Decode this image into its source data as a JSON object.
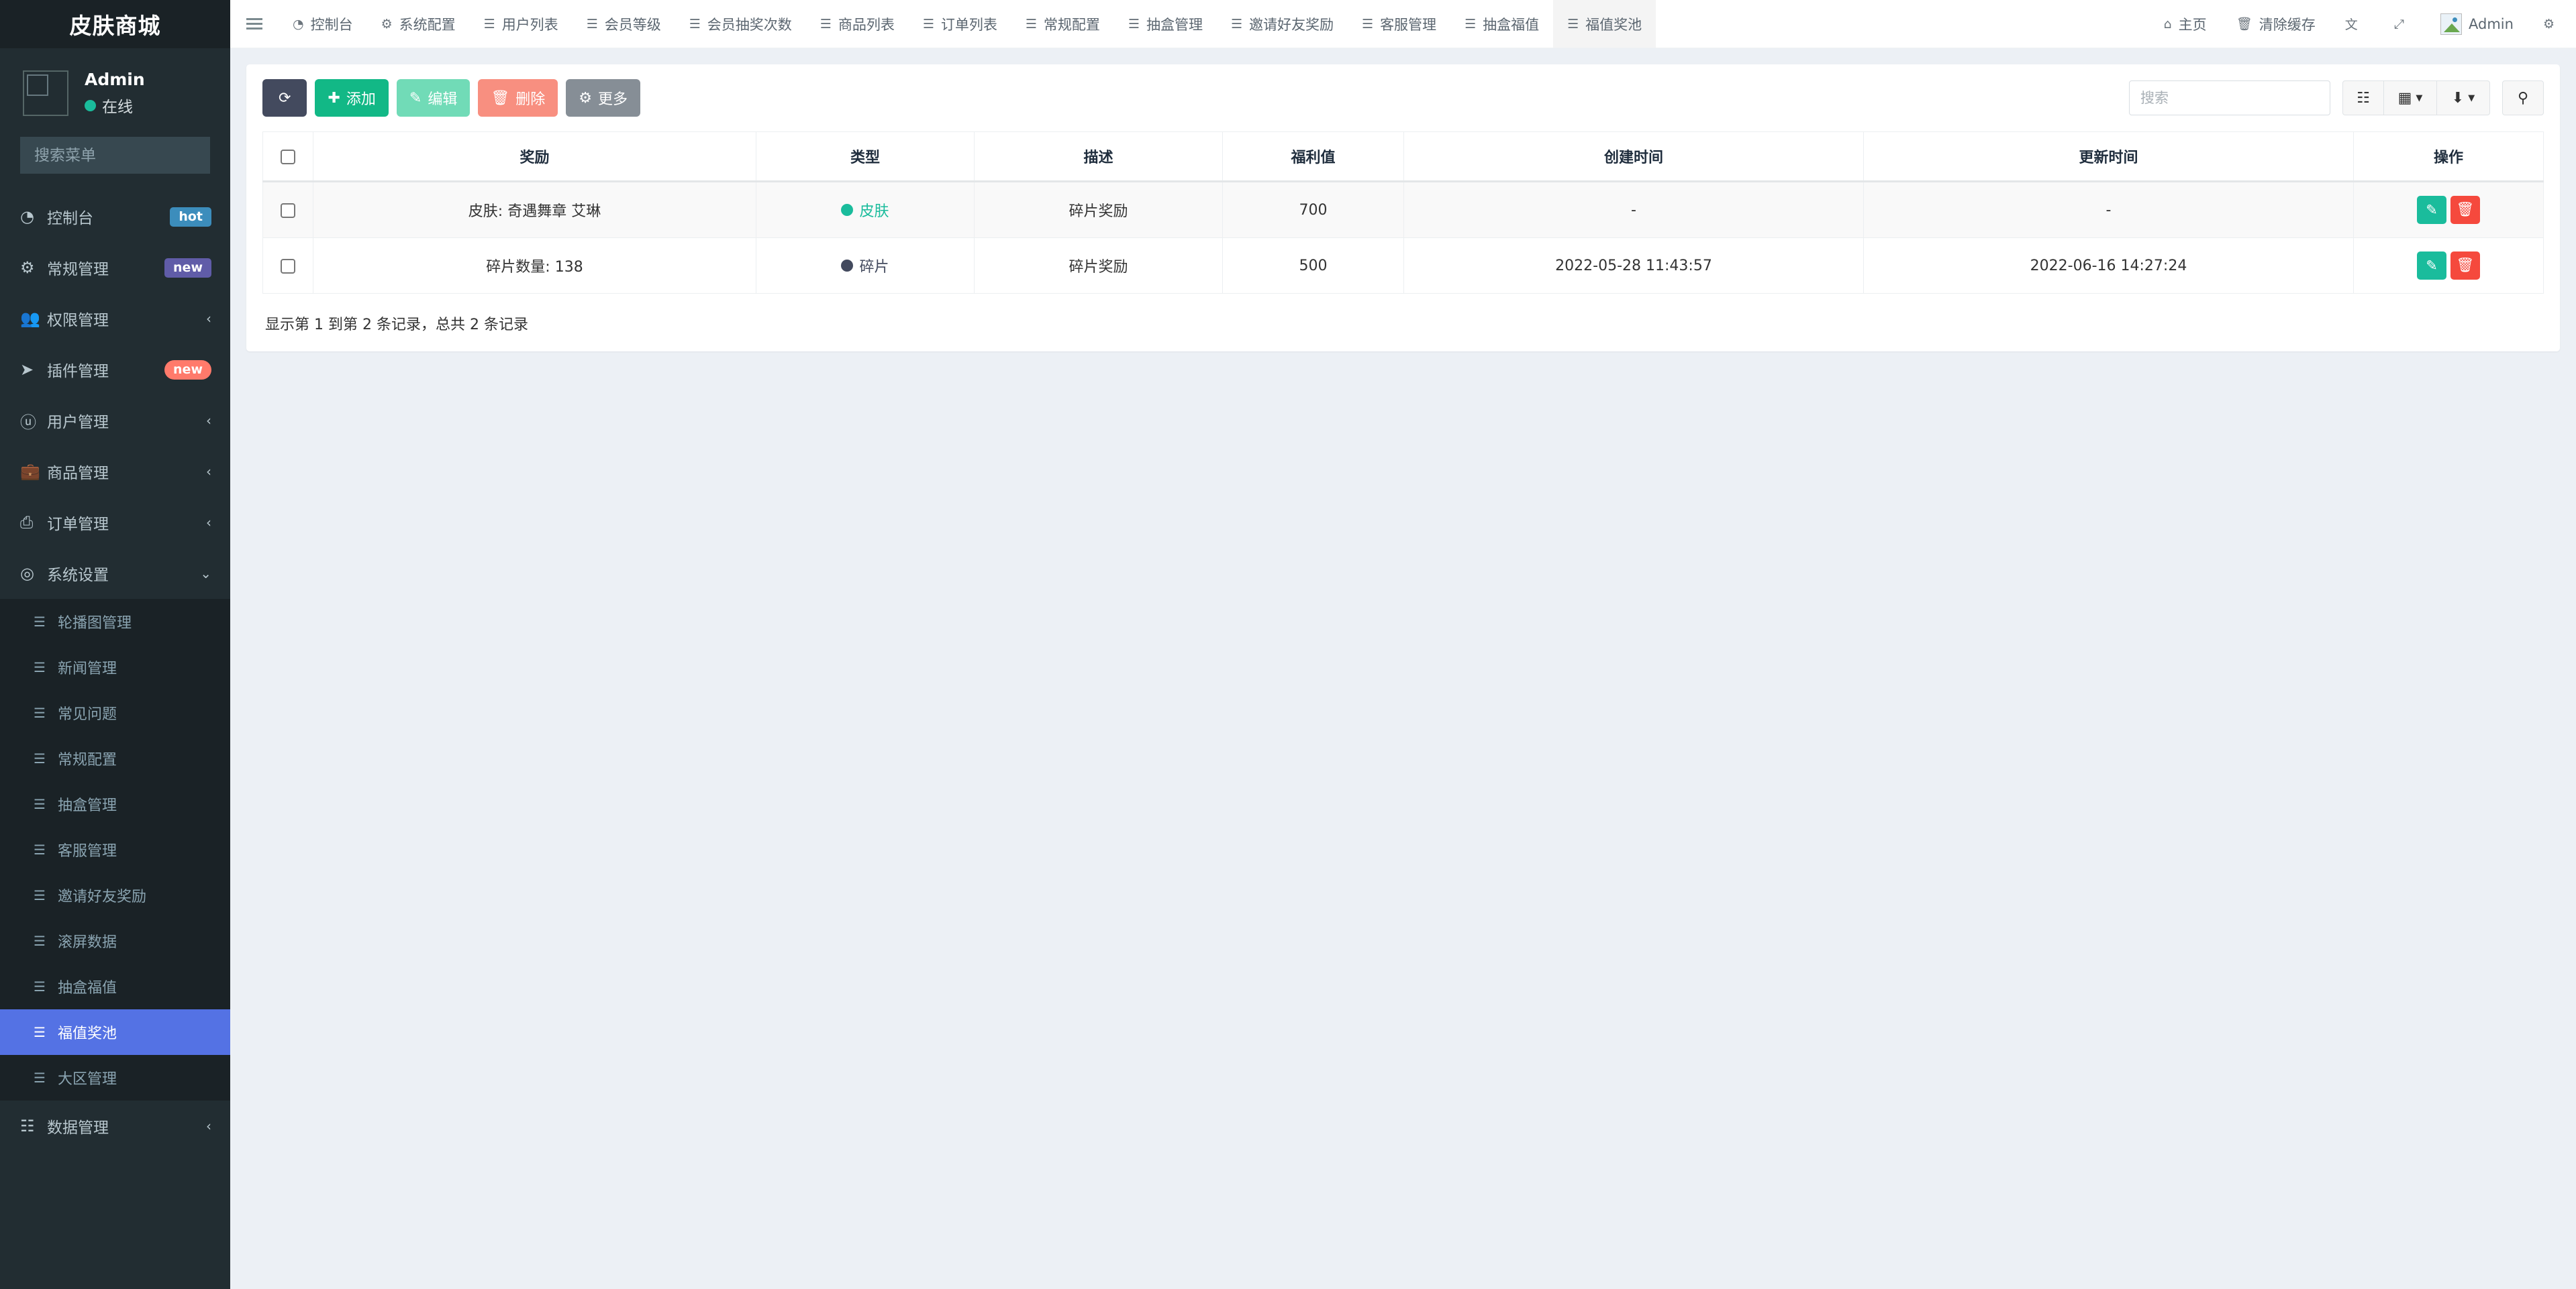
{
  "brand": {
    "title": "皮肤商城"
  },
  "user": {
    "name": "Admin",
    "status": "在线"
  },
  "menu_search": {
    "placeholder": "搜索菜单",
    "icon": "search-icon"
  },
  "sidebar": {
    "items": [
      {
        "label": "控制台",
        "icon": "dashboard-icon",
        "badge": "hot",
        "badge_style": "hot"
      },
      {
        "label": "常规管理",
        "icon": "cogs-icon",
        "badge": "new",
        "badge_style": "newp"
      },
      {
        "label": "权限管理",
        "icon": "users-icon",
        "caret": "‹"
      },
      {
        "label": "插件管理",
        "icon": "rocket-icon",
        "badge": "new",
        "badge_style": "newr"
      },
      {
        "label": "用户管理",
        "icon": "user-circle-icon",
        "caret": "‹"
      },
      {
        "label": "商品管理",
        "icon": "briefcase-icon",
        "caret": "‹"
      },
      {
        "label": "订单管理",
        "icon": "print-icon",
        "caret": "‹"
      },
      {
        "label": "系统设置",
        "icon": "circle-target-icon",
        "caret": "⌄"
      }
    ],
    "submenu": [
      {
        "label": "轮播图管理",
        "icon": "list-icon"
      },
      {
        "label": "新闻管理",
        "icon": "list-icon"
      },
      {
        "label": "常见问题",
        "icon": "list-icon"
      },
      {
        "label": "常规配置",
        "icon": "list-icon"
      },
      {
        "label": "抽盒管理",
        "icon": "list-icon"
      },
      {
        "label": "客服管理",
        "icon": "list-icon"
      },
      {
        "label": "邀请好友奖励",
        "icon": "list-icon"
      },
      {
        "label": "滚屏数据",
        "icon": "list-icon"
      },
      {
        "label": "抽盒福值",
        "icon": "list-icon"
      },
      {
        "label": "福值奖池",
        "icon": "list-icon",
        "active": true
      },
      {
        "label": "大区管理",
        "icon": "list-icon"
      }
    ],
    "tail": [
      {
        "label": "数据管理",
        "icon": "database-icon",
        "caret": "‹"
      }
    ]
  },
  "topnav": {
    "hamburger": "menu-toggle-icon",
    "tabs": [
      {
        "label": "控制台",
        "icon": "dashboard-icon"
      },
      {
        "label": "系统配置",
        "icon": "gear-icon"
      },
      {
        "label": "用户列表",
        "icon": "list-icon"
      },
      {
        "label": "会员等级",
        "icon": "list-icon"
      },
      {
        "label": "会员抽奖次数",
        "icon": "list-icon"
      },
      {
        "label": "商品列表",
        "icon": "list-icon"
      },
      {
        "label": "订单列表",
        "icon": "list-icon"
      },
      {
        "label": "常规配置",
        "icon": "list-icon"
      },
      {
        "label": "抽盒管理",
        "icon": "list-icon"
      },
      {
        "label": "邀请好友奖励",
        "icon": "list-icon"
      },
      {
        "label": "客服管理",
        "icon": "list-icon"
      },
      {
        "label": "抽盒福值",
        "icon": "list-icon"
      },
      {
        "label": "福值奖池",
        "icon": "list-icon",
        "active": true
      }
    ],
    "right": [
      {
        "label": "主页",
        "icon": "home-icon"
      },
      {
        "label": "清除缓存",
        "icon": "trash-icon"
      },
      {
        "label": "",
        "icon": "language-icon"
      },
      {
        "label": "",
        "icon": "fullscreen-icon"
      },
      {
        "label": "Admin",
        "icon": "avatar-icon"
      },
      {
        "label": "",
        "icon": "gear-icon"
      }
    ]
  },
  "toolbar": {
    "refresh_label": "",
    "refresh_icon": "refresh-icon",
    "add_label": "添加",
    "edit_label": "编辑",
    "delete_label": "删除",
    "more_label": "更多",
    "search_placeholder": "搜索",
    "search_value": "",
    "icons": {
      "columns": "columns-toggle-icon",
      "grid": "grid-view-icon",
      "export": "export-icon",
      "search": "search-icon"
    }
  },
  "table": {
    "columns": [
      "",
      "奖励",
      "类型",
      "描述",
      "福利值",
      "创建时间",
      "更新时间",
      "操作"
    ],
    "rows": [
      {
        "reward": "皮肤: 奇遇舞章 艾琳",
        "type": "皮肤",
        "type_color": "#1abc9c",
        "desc": "碎片奖励",
        "value": "700",
        "created": "-",
        "updated": "-"
      },
      {
        "reward": "碎片数量: 138",
        "type": "碎片",
        "type_color": "#434a5e",
        "desc": "碎片奖励",
        "value": "500",
        "created": "2022-05-28 11:43:57",
        "updated": "2022-06-16 14:27:24"
      }
    ],
    "row_actions": {
      "edit_icon": "pencil-icon",
      "delete_icon": "trash-icon"
    },
    "footer": "显示第 1 到第 2 条记录，总共 2 条记录"
  },
  "colors": {
    "sidebar_bg": "#222d32",
    "sidebar_active": "#5472e4",
    "accent_green": "#12b886",
    "accent_red": "#f5493d",
    "page_bg": "#ecf0f5"
  }
}
